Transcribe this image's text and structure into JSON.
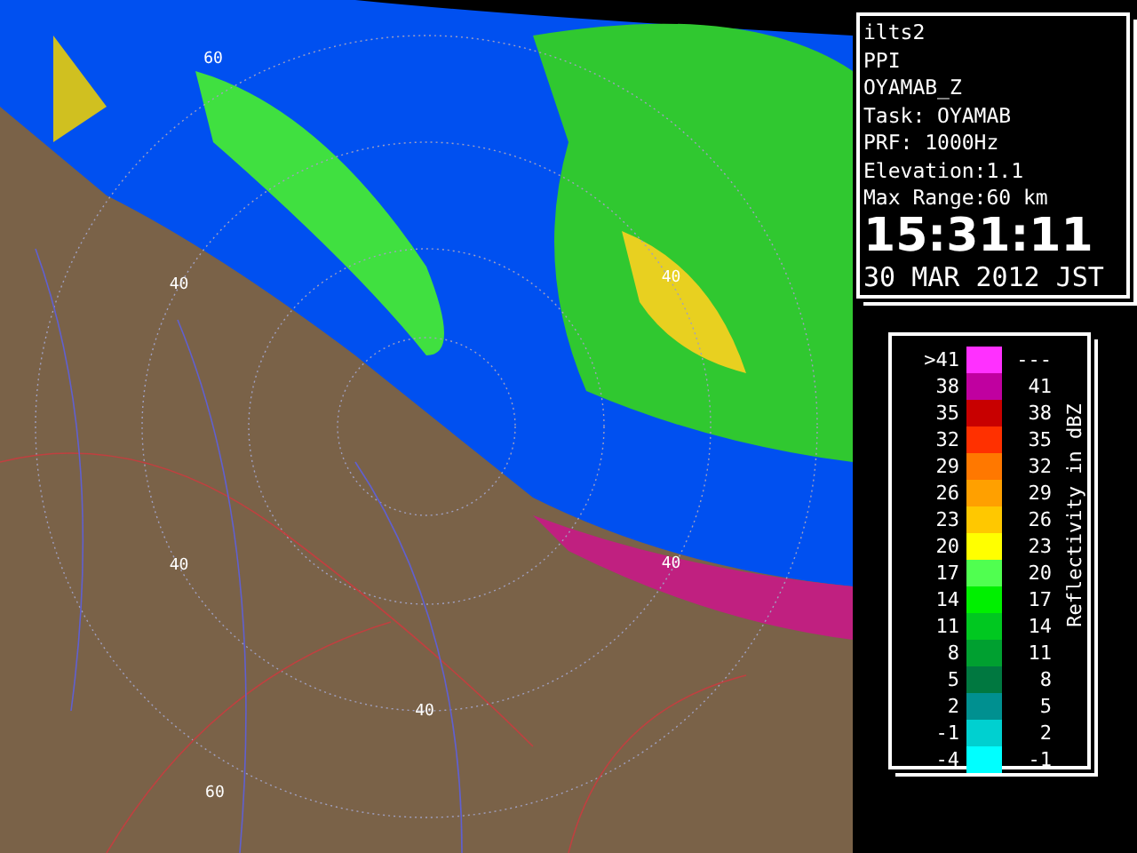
{
  "map": {
    "range_labels": [
      "60",
      "40",
      "40",
      "40",
      "40",
      "40",
      "60"
    ]
  },
  "info": {
    "lines": [
      "ilts2",
      "PPI",
      "OYAMAB_Z",
      "Task: OYAMAB",
      "PRF: 1000Hz",
      "Elevation:1.1",
      "Max Range:60 km"
    ],
    "time": "15:31:11",
    "date": "30 MAR 2012 JST"
  },
  "legend": {
    "title": "Reflectivity in dBZ",
    "entries": [
      {
        "low": ">41",
        "high": "---",
        "color": "#ff30ff"
      },
      {
        "low": "38",
        "high": "41",
        "color": "#c000a0"
      },
      {
        "low": "35",
        "high": "38",
        "color": "#c80000"
      },
      {
        "low": "32",
        "high": "35",
        "color": "#ff3000"
      },
      {
        "low": "29",
        "high": "32",
        "color": "#ff7800"
      },
      {
        "low": "26",
        "high": "29",
        "color": "#ffa000"
      },
      {
        "low": "23",
        "high": "26",
        "color": "#ffc800"
      },
      {
        "low": "20",
        "high": "23",
        "color": "#ffff00"
      },
      {
        "low": "17",
        "high": "20",
        "color": "#50ff50"
      },
      {
        "low": "14",
        "high": "17",
        "color": "#00f000"
      },
      {
        "low": "11",
        "high": "14",
        "color": "#00c820"
      },
      {
        "low": "8",
        "high": "11",
        "color": "#00a030"
      },
      {
        "low": "5",
        "high": "8",
        "color": "#007840"
      },
      {
        "low": "2",
        "high": "5",
        "color": "#009090"
      },
      {
        "low": "-1",
        "high": "2",
        "color": "#00d0d0"
      },
      {
        "low": "-4",
        "high": "-1",
        "color": "#00ffff"
      }
    ]
  }
}
